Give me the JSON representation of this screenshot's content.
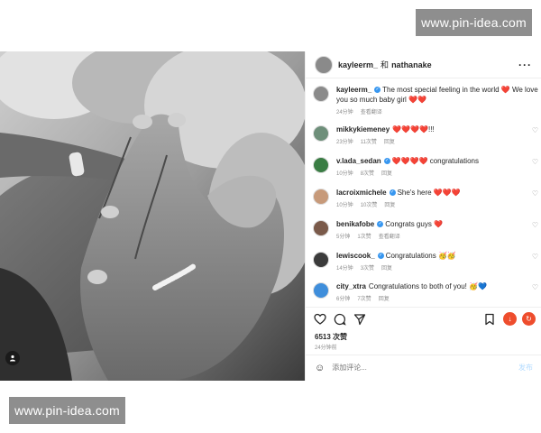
{
  "watermark": {
    "text": "www.pin-idea.com"
  },
  "post": {
    "header": {
      "user": "kayleerm_",
      "sep": "和",
      "collab": "nathanake",
      "more": "···"
    },
    "comments": [
      {
        "user": "kayleerm_",
        "text": "The most special feeling in the world ❤️ We love you so much baby girl ❤️❤️",
        "time": "24分钟",
        "likes": "",
        "action": "查看翻译",
        "avatar_color": "#8a8a8a"
      },
      {
        "user": "mikkykiemeney",
        "text": "❤️❤️❤️❤️!!!",
        "time": "23分钟",
        "likes": "11次赞",
        "action": "回复",
        "avatar_color": "#6e8f7a"
      },
      {
        "user": "v.lada_sedan",
        "text": "❤️❤️❤️❤️ congratulations",
        "time": "10分钟",
        "likes": "8次赞",
        "action": "回复",
        "avatar_color": "#3a7d44"
      },
      {
        "user": "lacroixmichele",
        "text": "She's here ❤️❤️❤️",
        "time": "10分钟",
        "likes": "10次赞",
        "action": "回复",
        "avatar_color": "#c79a7a"
      },
      {
        "user": "benikafobe",
        "text": "Congrats guys ❤️",
        "time": "5分钟",
        "likes": "1次赞",
        "action": "查看翻译",
        "avatar_color": "#7a5a4a"
      },
      {
        "user": "lewiscook_",
        "text": "Congratulations 🥳🥳",
        "time": "14分钟",
        "likes": "3次赞",
        "action": "回复",
        "avatar_color": "#3b3b3b"
      },
      {
        "user": "city_xtra",
        "text": "Congratulations to both of you! 🥳💙",
        "time": "6分钟",
        "likes": "7次赞",
        "action": "回复",
        "avatar_color": "#3f8edb"
      }
    ],
    "likes": "6513 次赞",
    "time": "24分钟前",
    "add_comment": {
      "placeholder": "添加评论...",
      "post_label": "发布",
      "smile": "☺"
    },
    "heart_glyph": "♡"
  }
}
